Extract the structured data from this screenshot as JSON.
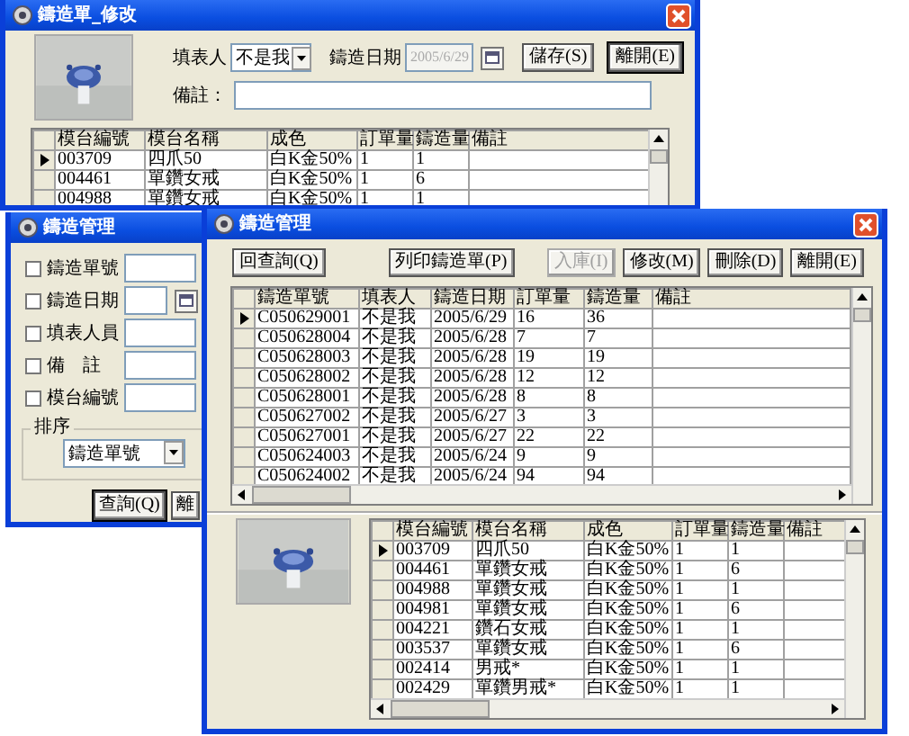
{
  "edit_window": {
    "title": "鑄造單_修改",
    "filler_label": "填表人",
    "filler_value": "不是我",
    "date_label": "鑄造日期",
    "date_value": "2005/6/29",
    "date_disabled": true,
    "note_label": "備註：",
    "buttons": [
      {
        "label": "儲存(S)",
        "default": false
      },
      {
        "label": "離開(E)",
        "default": true
      }
    ],
    "table": {
      "columns": [
        "模台編號",
        "模台名稱",
        "成色",
        "訂單量",
        "鑄造量",
        "備註"
      ],
      "rows": [
        {
          "cells": [
            "003709",
            "四爪50",
            "白K金50%",
            "1",
            "1"
          ],
          "selected": true
        },
        {
          "cells": [
            "004461",
            "單鑽女戒",
            "白K金50%",
            "1",
            "6"
          ],
          "selected": false
        },
        {
          "cells": [
            "004988",
            "單鑽女戒",
            "白K金50%",
            "1",
            "1"
          ],
          "selected": false
        }
      ]
    }
  },
  "search_window": {
    "title": "鑄造管理",
    "filters": [
      {
        "label": "鑄造單號",
        "kind": "text",
        "checked": false
      },
      {
        "label": "鑄造日期",
        "kind": "date",
        "checked": false
      },
      {
        "label": "填表人員",
        "kind": "text",
        "checked": false
      },
      {
        "label": "備　註",
        "kind": "text",
        "checked": false
      },
      {
        "label": "模台編號",
        "kind": "text",
        "checked": false
      }
    ],
    "sort": {
      "label": "排序",
      "value": "鑄造單號"
    },
    "buttons": [
      {
        "label": "查詢(Q)",
        "default": true
      },
      {
        "label": "離",
        "default": false
      }
    ]
  },
  "manage_window": {
    "title": "鑄造管理",
    "buttons": [
      {
        "label": "回查詢(Q)",
        "disabled": false
      },
      {
        "label": "列印鑄造單(P)",
        "disabled": false
      },
      {
        "label": "入庫(I)",
        "disabled": true
      },
      {
        "label": "修改(M)",
        "disabled": false
      },
      {
        "label": "刪除(D)",
        "disabled": false
      },
      {
        "label": "離開(E)",
        "disabled": false
      }
    ],
    "orders": {
      "columns": [
        "鑄造單號",
        "填表人",
        "鑄造日期",
        "訂單量",
        "鑄造量",
        "備註"
      ],
      "rows": [
        {
          "cells": [
            "C050629001",
            "不是我",
            "2005/6/29",
            "16",
            "36"
          ],
          "selected": true
        },
        {
          "cells": [
            "C050628004",
            "不是我",
            "2005/6/28",
            "7",
            "7"
          ],
          "selected": false
        },
        {
          "cells": [
            "C050628003",
            "不是我",
            "2005/6/28",
            "19",
            "19"
          ],
          "selected": false
        },
        {
          "cells": [
            "C050628002",
            "不是我",
            "2005/6/28",
            "12",
            "12"
          ],
          "selected": false
        },
        {
          "cells": [
            "C050628001",
            "不是我",
            "2005/6/28",
            "8",
            "8"
          ],
          "selected": false
        },
        {
          "cells": [
            "C050627002",
            "不是我",
            "2005/6/27",
            "3",
            "3"
          ],
          "selected": false
        },
        {
          "cells": [
            "C050627001",
            "不是我",
            "2005/6/27",
            "22",
            "22"
          ],
          "selected": false
        },
        {
          "cells": [
            "C050624003",
            "不是我",
            "2005/6/24",
            "9",
            "9"
          ],
          "selected": false
        },
        {
          "cells": [
            "C050624002",
            "不是我",
            "2005/6/24",
            "94",
            "94"
          ],
          "selected": false
        }
      ]
    },
    "details": {
      "columns": [
        "模台編號",
        "模台名稱",
        "成色",
        "訂單量",
        "鑄造量",
        "備註"
      ],
      "rows": [
        {
          "cells": [
            "003709",
            "四爪50",
            "白K金50%",
            "1",
            "1"
          ],
          "selected": true
        },
        {
          "cells": [
            "004461",
            "單鑽女戒",
            "白K金50%",
            "1",
            "6"
          ],
          "selected": false
        },
        {
          "cells": [
            "004988",
            "單鑽女戒",
            "白K金50%",
            "1",
            "1"
          ],
          "selected": false
        },
        {
          "cells": [
            "004981",
            "單鑽女戒",
            "白K金50%",
            "1",
            "6"
          ],
          "selected": false
        },
        {
          "cells": [
            "004221",
            "鑽石女戒",
            "白K金50%",
            "1",
            "1"
          ],
          "selected": false
        },
        {
          "cells": [
            "003537",
            "單鑽女戒",
            "白K金50%",
            "1",
            "6"
          ],
          "selected": false
        },
        {
          "cells": [
            "002414",
            "男戒*",
            "白K金50%",
            "1",
            "1"
          ],
          "selected": false
        },
        {
          "cells": [
            "002429",
            "單鑽男戒*",
            "白K金50%",
            "1",
            "1"
          ],
          "selected": false
        }
      ]
    }
  }
}
